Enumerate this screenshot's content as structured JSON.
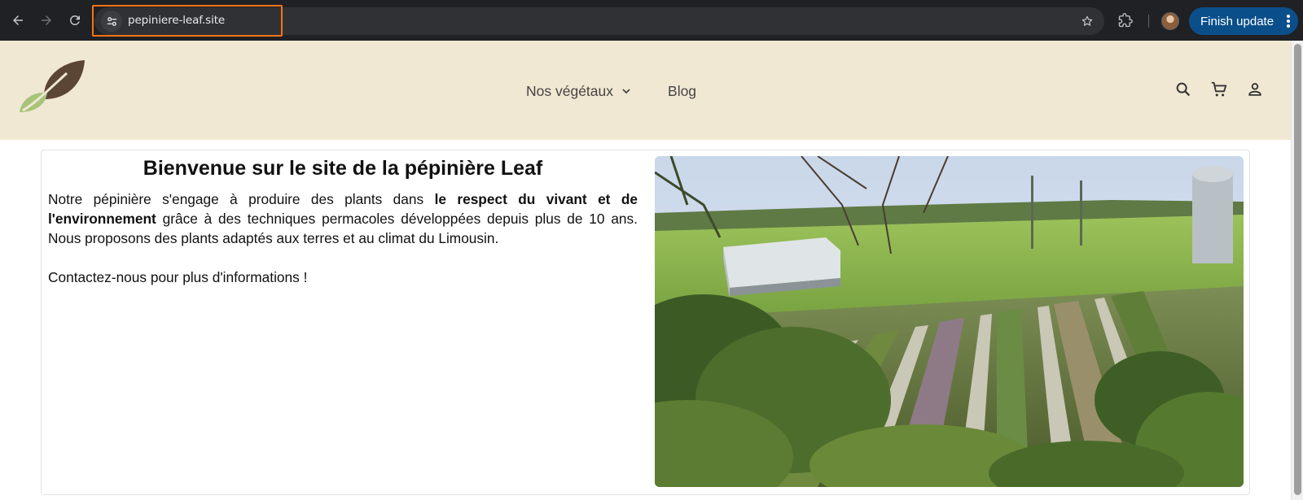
{
  "browser": {
    "url": "pepiniere-leaf.site",
    "finish_update_label": "Finish update",
    "icons": [
      "back-icon",
      "forward-icon",
      "reload-icon",
      "site-info-icon",
      "bookmark-star-icon",
      "extensions-icon",
      "profile-avatar",
      "more-vert-icon"
    ],
    "focus_color": "#f97316",
    "update_button_color": "#0b4f8a"
  },
  "site": {
    "header_bg": "#f0e8d2",
    "logo": "leaf-logo",
    "nav": {
      "items": [
        {
          "label": "Nos végétaux",
          "has_dropdown": true
        },
        {
          "label": "Blog",
          "has_dropdown": false
        }
      ]
    },
    "header_icons": [
      "search-icon",
      "cart-icon",
      "account-icon"
    ]
  },
  "intro": {
    "title": "Bienvenue sur le site de la pépinière Leaf",
    "text_before_bold": "Notre pépinière s'engage à produire des plants dans ",
    "text_bold": "le respect du vivant et de l'environnement",
    "text_after_bold": " grâce à des techniques permacoles développées depuis plus de 10 ans. Nous proposons des plants adaptés aux terres et au climat du Limousin.",
    "contact": "Contactez-nous pour plus d'informations !",
    "image": "nursery-landscape-photo"
  }
}
